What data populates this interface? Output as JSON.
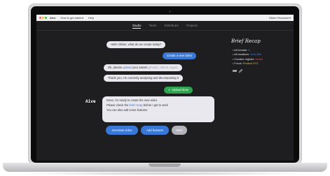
{
  "menubar": {
    "app": "Aive",
    "items": [
      "How to get started",
      "Help"
    ],
    "user": "Olivier Ruzzead ▾"
  },
  "tabs": [
    "Studio",
    "Team",
    "Distributor",
    "Projects"
  ],
  "chat": {
    "greeting": "Hello Olivier, what do we create today?",
    "create_video": "Create a new video",
    "upload_pre": "Ok, please ",
    "upload_link": "upload",
    "upload_post": " your assets",
    "upload_hint": "(photos, videos, logos)",
    "analyzing": "Thank you, I'm currently analysing and decomposing it",
    "upload_done": "Upload done",
    "aive_name": "Aive",
    "ready": "Done, I'm ready to create the new video",
    "check_pre": "Please check the ",
    "check_link": "brief recap",
    "check_post": " before I get to work",
    "features": "You can also add some features"
  },
  "actions": {
    "generate": "Generate video",
    "add_features": "Add features",
    "more": "More"
  },
  "brief": {
    "title": "Brief Recap",
    "items": [
      {
        "label": "All formats: ",
        "value": "3"
      },
      {
        "label": "All durations: ",
        "value": "7s to 30s"
      },
      {
        "label": "Creative register: ",
        "value": "verbal"
      },
      {
        "label": "Focus: ",
        "value": "Product XYZ"
      }
    ]
  },
  "colors": {
    "accent_blue": "#3a78d8",
    "success_green": "#2ea44f",
    "screen_bg": "#1e1e21",
    "bubble_bg": "#e8e8ee"
  }
}
